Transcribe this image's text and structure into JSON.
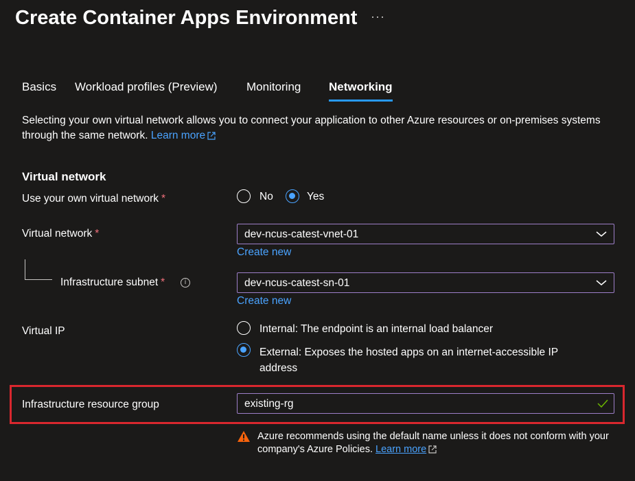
{
  "header": {
    "title": "Create Container Apps Environment",
    "more": "···"
  },
  "tabs": [
    {
      "label": "Basics"
    },
    {
      "label": "Workload profiles (Preview)"
    },
    {
      "label": "Monitoring"
    },
    {
      "label": "Networking"
    }
  ],
  "active_tab": "Networking",
  "description": {
    "text": "Selecting your own virtual network allows you to connect your application to other Azure resources or on-premises systems through the same network.",
    "learn_more": "Learn more"
  },
  "virtual_network_section": {
    "heading": "Virtual network",
    "use_own_vnet": {
      "label": "Use your own virtual network",
      "required": "*",
      "options": [
        "No",
        "Yes"
      ],
      "selected": "Yes"
    },
    "virtual_network": {
      "label": "Virtual network",
      "required": "*",
      "value": "dev-ncus-catest-vnet-01",
      "create_new": "Create new"
    },
    "infrastructure_subnet": {
      "label": "Infrastructure subnet",
      "required": "*",
      "info": "i",
      "value": "dev-ncus-catest-sn-01",
      "create_new": "Create new"
    },
    "virtual_ip": {
      "label": "Virtual IP",
      "options": [
        "Internal: The endpoint is an internal load balancer",
        "External: Exposes the hosted apps on an internet-accessible IP address"
      ],
      "selected": "External"
    },
    "infrastructure_rg": {
      "label": "Infrastructure resource group",
      "value": "existing-rg"
    },
    "warning": {
      "text": "Azure recommends using the default name unless it does not conform with your company's Azure Policies.",
      "learn_more": "Learn more"
    }
  },
  "colors": {
    "accent": "#4aa3ff",
    "highlight": "#d9272e",
    "warning": "#fce100",
    "success": "#6bb700"
  }
}
